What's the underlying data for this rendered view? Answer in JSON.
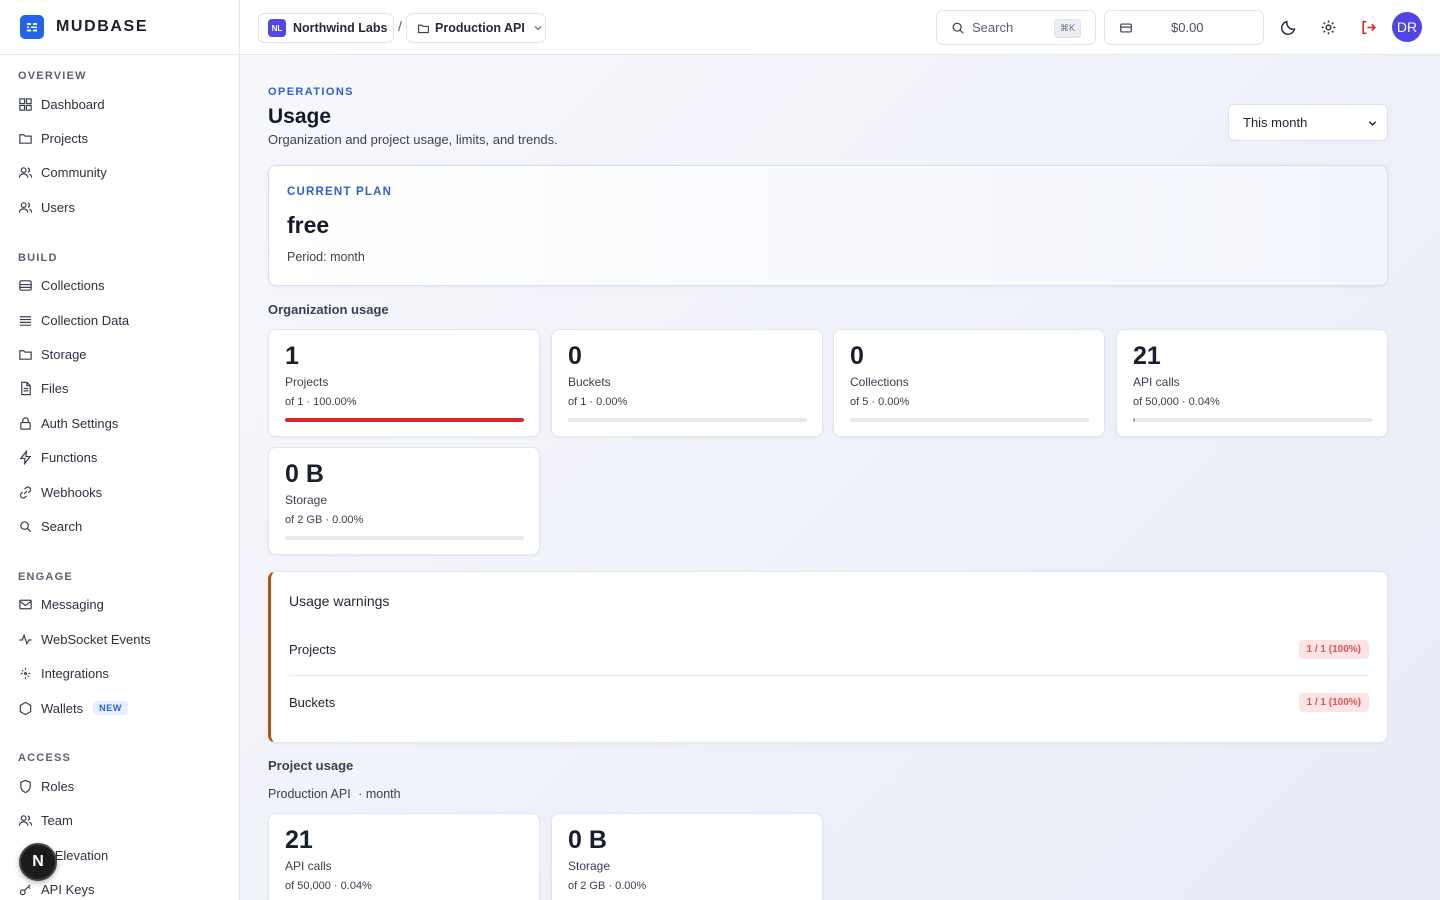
{
  "brand": {
    "name": "MUDBASE"
  },
  "sidebar": {
    "sections": [
      {
        "title": "OVERVIEW",
        "items": [
          "Dashboard",
          "Projects",
          "Community",
          "Users"
        ]
      },
      {
        "title": "BUILD",
        "items": [
          "Collections",
          "Collection Data",
          "Storage",
          "Files",
          "Auth Settings",
          "Functions",
          "Webhooks",
          "Search"
        ]
      },
      {
        "title": "ENGAGE",
        "items": [
          "Messaging",
          "WebSocket Events",
          "Integrations",
          "Wallets"
        ]
      },
      {
        "title": "ACCESS",
        "items": [
          "Roles",
          "Team",
          "le Elevation",
          "API Keys"
        ]
      }
    ],
    "new_badge": "NEW",
    "fab_label": "N"
  },
  "topbar": {
    "org_initials": "NL",
    "org_name": "Northwind Labs",
    "separator": "/",
    "project_name": "Production API",
    "search_label": "Search",
    "search_shortcut": "⌘K",
    "credit": "$0.00",
    "user_initials": "DR"
  },
  "page": {
    "eyebrow": "OPERATIONS",
    "title": "Usage",
    "subtitle": "Organization and project usage, limits, and trends.",
    "period_selected": "This month"
  },
  "plan": {
    "label": "CURRENT PLAN",
    "name": "free",
    "period": "Period: month"
  },
  "org_usage": {
    "title": "Organization usage",
    "metrics": [
      {
        "value": "1",
        "label": "Projects",
        "sub": "of 1 · 100.00%",
        "percent": 100
      },
      {
        "value": "0",
        "label": "Buckets",
        "sub": "of 1 · 0.00%",
        "percent": 0
      },
      {
        "value": "0",
        "label": "Collections",
        "sub": "of 5 · 0.00%",
        "percent": 0
      },
      {
        "value": "21",
        "label": "API calls",
        "sub": "of 50,000 · 0.04%",
        "percent": 0.04
      },
      {
        "value": "0 B",
        "label": "Storage",
        "sub": "of 2 GB · 0.00%",
        "percent": 0
      }
    ]
  },
  "warnings": {
    "title": "Usage warnings",
    "rows": [
      {
        "label": "Projects",
        "badge": "1 / 1 (100%)"
      },
      {
        "label": "Buckets",
        "badge": "1 / 1 (100%)"
      }
    ]
  },
  "project_usage": {
    "title": "Project usage",
    "project": "Production API",
    "period": "· month",
    "metrics": [
      {
        "value": "21",
        "label": "API calls",
        "sub": "of 50,000 · 0.04%",
        "percent": 0.04
      },
      {
        "value": "0 B",
        "label": "Storage",
        "sub": "of 2 GB · 0.00%",
        "percent": 0
      }
    ]
  }
}
